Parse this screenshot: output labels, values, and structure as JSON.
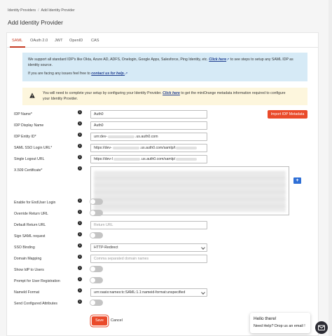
{
  "breadcrumb": {
    "items": [
      "Identity Providers",
      "Add Identity Provider"
    ],
    "separator": "/"
  },
  "page": {
    "title": "Add Identity Provider"
  },
  "tabs": [
    {
      "label": "SAML",
      "active": true
    },
    {
      "label": "OAuth 2.0",
      "active": false
    },
    {
      "label": "JWT",
      "active": false
    },
    {
      "label": "OpenID",
      "active": false
    },
    {
      "label": "CAS",
      "active": false
    }
  ],
  "info": {
    "line1_text": "We support all standard IDP's like Okta, Azure AD, ADFS, Onelogin, Google Apps, Salesforce, Ping Identity, etc.",
    "line1_link": "Click here",
    "line1_after": "to see steps to setup any SAML IDP as",
    "line2_text": "identity source.",
    "line3_text": "If you are facing any issues feel free to",
    "line3_link": "contact us for help."
  },
  "warning": {
    "line1_text": "You will need to complete your setup by configuring your Identity Provider.",
    "line1_link": "Click here",
    "line1_after": "to get the miniOrange metadata information required to configure",
    "line2_text": "your Identity Provider."
  },
  "form": {
    "idp_name": {
      "label": "IDP Name*",
      "value": "Auth0"
    },
    "idp_display_name": {
      "label": "IDP Display Name",
      "value": "Auth0"
    },
    "idp_entity_id": {
      "label": "IDP Entity ID*",
      "value_prefix": "urn:dev-",
      "value_suffix": ".us.auth0.com"
    },
    "saml_sso_url": {
      "label": "SAML SSO Login URL*",
      "value_prefix": "https://dev-",
      "value_suffix": ".us.auth0.com/samlp/t"
    },
    "single_logout_url": {
      "label": "Single Logout URL",
      "value_prefix": "https://dev-l",
      "value_suffix": ".us.auth0.com/samlp/"
    },
    "x509": {
      "label": "X.509 Certificate*"
    },
    "enable_enduser_login": {
      "label": "Enable for EndUser Login",
      "on": false
    },
    "override_return_url": {
      "label": "Override Return URL",
      "on": false
    },
    "default_return_url": {
      "label": "Default Return URL",
      "placeholder": "Return URL"
    },
    "sign_saml_request": {
      "label": "Sign SAML request",
      "on": false
    },
    "sso_binding": {
      "label": "SSO Binding",
      "value": "HTTP-Redirect"
    },
    "domain_mapping": {
      "label": "Domain Mapping",
      "placeholder": "Comma separated domain names"
    },
    "show_idp_to_users": {
      "label": "Show IdP to Users",
      "on": false
    },
    "prompt_registration": {
      "label": "Prompt for User Registration",
      "on": false
    },
    "nameid_format": {
      "label": "NameId Format",
      "value": "urn:oasis:names:tc:SAML:1.1:nameid-format:unspecified"
    },
    "send_configured_attributes": {
      "label": "Send Configured Attributes",
      "on": false
    }
  },
  "help_icon_glyph": "i",
  "buttons": {
    "import_metadata": "Import IDP Metadata",
    "add_cert": "+",
    "save": "Save",
    "cancel": "Cancel"
  },
  "chat": {
    "greeting": "Hello there!",
    "prompt": "Need Help? Drop us an email !"
  },
  "colors": {
    "accent": "#ea4a2a",
    "tab_active": "#c53a22",
    "info_bg": "#d6eaf6",
    "warning_bg": "#fdf6dd",
    "link": "#1f3e90",
    "add_button": "#2f6fd6"
  }
}
